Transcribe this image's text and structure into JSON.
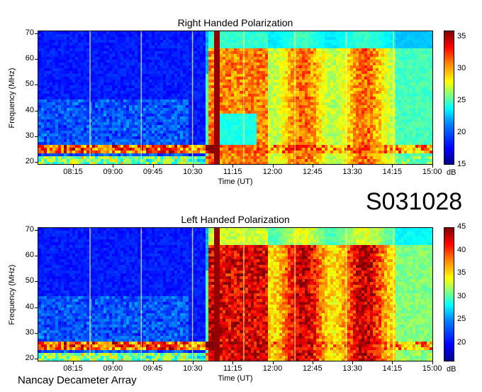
{
  "figure": {
    "session_id": "S031028",
    "observatory": "Nancay Decameter Array"
  },
  "chart_data": [
    {
      "type": "heatmap",
      "title": "Right Handed Polarization",
      "xlabel": "Time (UT)",
      "ylabel": "Frequency (MHz)",
      "x_tick_labels": [
        "08:15",
        "09:00",
        "09:45",
        "10:30",
        "11:15",
        "12:00",
        "12:45",
        "13:30",
        "14:15",
        "15:00"
      ],
      "y_ticks": [
        20,
        30,
        40,
        50,
        60,
        70
      ],
      "ylim": [
        20,
        70
      ],
      "colorbar": {
        "ticks": [
          15,
          20,
          25,
          30,
          35
        ],
        "range": [
          15,
          36
        ],
        "unit": "dB"
      }
    },
    {
      "type": "heatmap",
      "title": "Left Handed Polarization",
      "xlabel": "Time (UT)",
      "ylabel": "Frequency (MHz)",
      "x_tick_labels": [
        "08:15",
        "09:00",
        "09:45",
        "10:30",
        "11:15",
        "12:00",
        "12:45",
        "13:30",
        "14:15",
        "15:00"
      ],
      "y_ticks": [
        20,
        30,
        40,
        50,
        60,
        70
      ],
      "ylim": [
        20,
        70
      ],
      "colorbar": {
        "ticks": [
          20,
          25,
          30,
          35,
          40,
          45
        ],
        "range": [
          16,
          45
        ],
        "unit": "dB"
      }
    }
  ]
}
